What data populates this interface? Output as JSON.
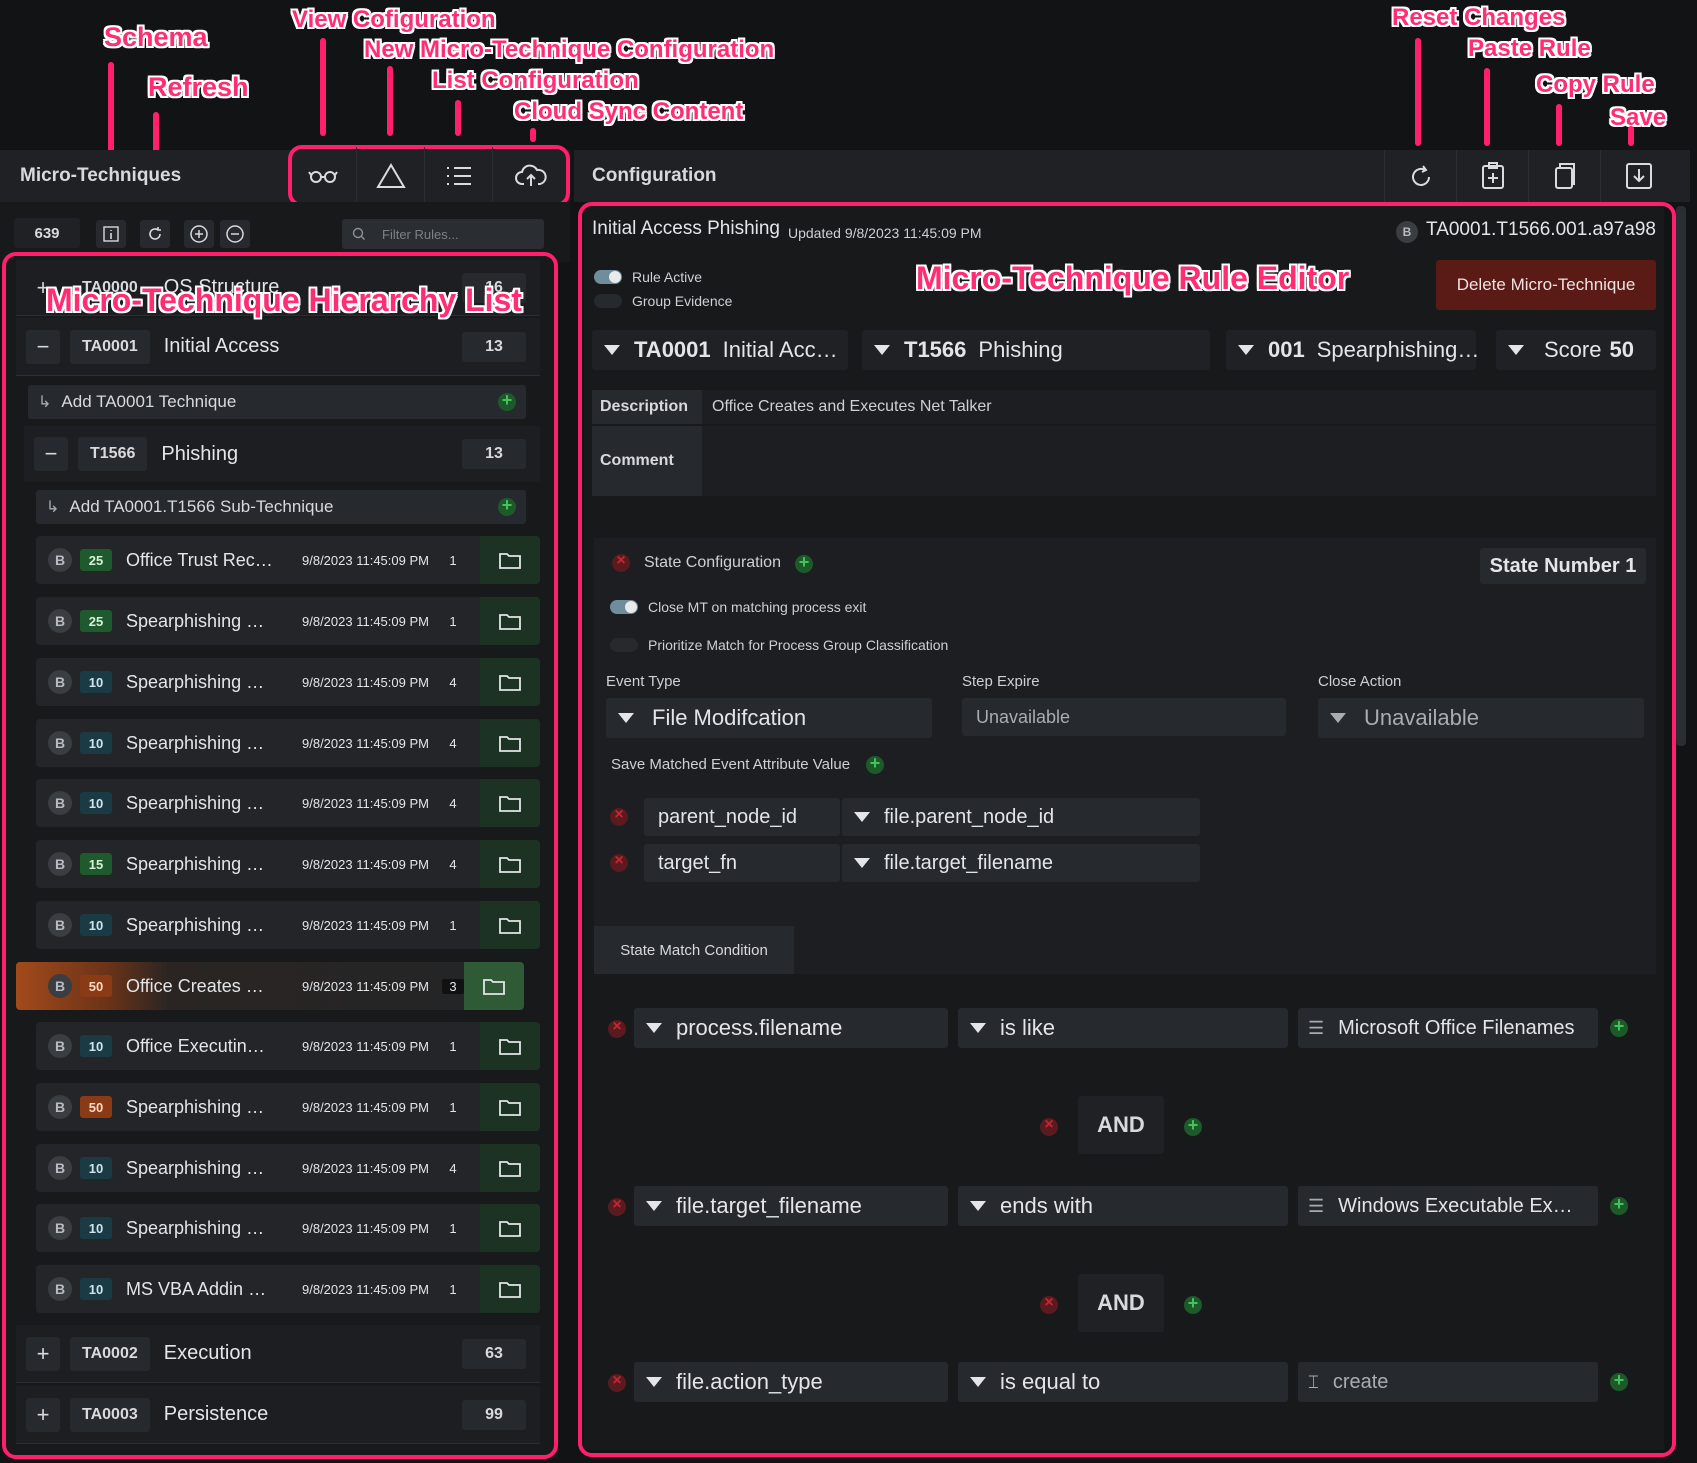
{
  "callouts": {
    "schema": "Schema",
    "refresh": "Refresh",
    "view_config": "View Cofiguration",
    "new_mt": "New Micro-Technique Configuration",
    "list_config": "List Configuration",
    "cloud_sync": "Cloud Sync Content",
    "reset_changes": "Reset Changes",
    "paste_rule": "Paste Rule",
    "copy_rule": "Copy Rule",
    "save": "Save",
    "hierarchy_list": "Micro-Technique Hierarchy List",
    "rule_editor": "Micro-Technique Rule Editor"
  },
  "left_panel": {
    "title": "Micro-Techniques",
    "rule_count": "639",
    "filter_placeholder": "Filter Rules...",
    "groups": [
      {
        "id": "TA0000",
        "name": "OS Structure",
        "count": "16",
        "sign": "+"
      },
      {
        "id": "TA0001",
        "name": "Initial Access",
        "count": "13",
        "sign": "−"
      },
      {
        "id": "TA0002",
        "name": "Execution",
        "count": "63",
        "sign": "+"
      },
      {
        "id": "TA0003",
        "name": "Persistence",
        "count": "99",
        "sign": "+"
      }
    ],
    "add_technique": "Add TA0001 Technique",
    "technique": {
      "id": "T1566",
      "name": "Phishing",
      "count": "13",
      "sign": "−"
    },
    "add_subtechnique": "Add TA0001.T1566 Sub-Technique",
    "rules": [
      {
        "letter": "B",
        "score": "25",
        "color": "green",
        "name": "Office Trust Rec…",
        "date": "9/8/2023 11:45:09 PM",
        "count": "1"
      },
      {
        "letter": "B",
        "score": "25",
        "color": "green",
        "name": "Spearphishing …",
        "date": "9/8/2023 11:45:09 PM",
        "count": "1"
      },
      {
        "letter": "B",
        "score": "10",
        "color": "teal",
        "name": "Spearphishing …",
        "date": "9/8/2023 11:45:09 PM",
        "count": "4"
      },
      {
        "letter": "B",
        "score": "10",
        "color": "teal",
        "name": "Spearphishing …",
        "date": "9/8/2023 11:45:09 PM",
        "count": "4"
      },
      {
        "letter": "B",
        "score": "10",
        "color": "teal",
        "name": "Spearphishing …",
        "date": "9/8/2023 11:45:09 PM",
        "count": "4"
      },
      {
        "letter": "B",
        "score": "15",
        "color": "green",
        "name": "Spearphishing …",
        "date": "9/8/2023 11:45:09 PM",
        "count": "4"
      },
      {
        "letter": "B",
        "score": "10",
        "color": "teal",
        "name": "Spearphishing …",
        "date": "9/8/2023 11:45:09 PM",
        "count": "1"
      },
      {
        "letter": "B",
        "score": "50",
        "color": "orange",
        "name": "Office Creates …",
        "date": "9/8/2023 11:45:09 PM",
        "count": "3",
        "selected": true
      },
      {
        "letter": "B",
        "score": "10",
        "color": "teal",
        "name": "Office Executin…",
        "date": "9/8/2023 11:45:09 PM",
        "count": "1"
      },
      {
        "letter": "B",
        "score": "50",
        "color": "orange",
        "name": "Spearphishing …",
        "date": "9/8/2023 11:45:09 PM",
        "count": "1"
      },
      {
        "letter": "B",
        "score": "10",
        "color": "teal",
        "name": "Spearphishing …",
        "date": "9/8/2023 11:45:09 PM",
        "count": "4"
      },
      {
        "letter": "B",
        "score": "10",
        "color": "teal",
        "name": "Spearphishing …",
        "date": "9/8/2023 11:45:09 PM",
        "count": "1"
      },
      {
        "letter": "B",
        "score": "10",
        "color": "teal",
        "name": "MS VBA Addin …",
        "date": "9/8/2023 11:45:09 PM",
        "count": "1"
      }
    ]
  },
  "right_panel": {
    "title": "Configuration",
    "rule_title": "Initial Access Phishing",
    "updated": "Updated 9/8/2023 11:45:09 PM",
    "rule_letter": "B",
    "rule_id": "TA0001.T1566.001.a97a98",
    "rule_active_label": "Rule Active",
    "group_evidence_label": "Group Evidence",
    "delete_label": "Delete Micro-Technique",
    "tactic_id": "TA0001",
    "tactic_name": "Initial Acc…",
    "technique_id": "T1566",
    "technique_name": "Phishing",
    "sub_id": "001",
    "sub_name": "Spearphishing…",
    "score_label": "Score",
    "score_value": "50",
    "description_label": "Description",
    "description_value": "Office Creates and Executes Net Talker",
    "comment_label": "Comment",
    "comment_value": "",
    "state": {
      "config_label": "State Configuration",
      "state_number": "State Number 1",
      "close_on_exit": "Close MT on matching process exit",
      "prioritize": "Prioritize Match for Process Group Classification",
      "event_type_label": "Event Type",
      "event_type_value": "File Modifcation",
      "step_expire_label": "Step Expire",
      "step_expire_value": "Unavailable",
      "close_action_label": "Close Action",
      "close_action_value": "Unavailable",
      "save_attr_label": "Save Matched Event Attribute Value",
      "attributes": [
        {
          "name": "parent_node_id",
          "field": "file.parent_node_id"
        },
        {
          "name": "target_fn",
          "field": "file.target_filename"
        }
      ],
      "match_tab": "State Match Condition",
      "conditions": [
        {
          "field": "process.filename",
          "op": "is like",
          "value": "Microsoft Office Filenames",
          "list": true
        },
        {
          "field": "file.target_filename",
          "op": "ends with",
          "value": "Windows Executable Ex…",
          "list": true
        },
        {
          "field": "file.action_type",
          "op": "is equal to",
          "value": "create",
          "list": false
        }
      ],
      "joiners": [
        "AND",
        "AND"
      ]
    }
  },
  "colors": {
    "highlight": "#ff1f6b",
    "selected_row": "#8a3a14",
    "delete_button": "#5a1a16"
  }
}
